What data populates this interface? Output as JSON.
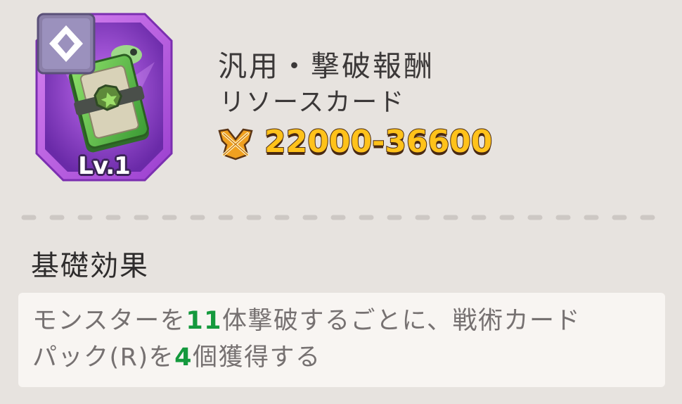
{
  "card": {
    "level": "Lv.1",
    "title": "汎用・撃破報酬",
    "type": "リソースカード",
    "icon": "resource-card-art",
    "rarity_badge_icon": "diamond-icon",
    "frame_color": "#b25ad9"
  },
  "power": {
    "icon": "crossed-swords-icon",
    "range": "22000-36600",
    "color": "#ffc21a"
  },
  "basic_effect": {
    "title": "基礎効果",
    "line1_a": "モンスターを",
    "line1_num": "11",
    "line1_b": "体撃破するごとに、戦術カード",
    "line2_a": "パック(R)を",
    "line2_num": "4",
    "line2_b": "個獲得する",
    "number_color": "#14993d"
  }
}
